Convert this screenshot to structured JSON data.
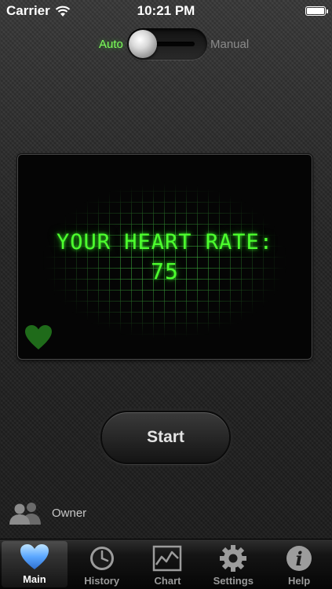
{
  "status_bar": {
    "carrier": "Carrier",
    "time": "10:21 PM"
  },
  "mode": {
    "auto_label": "Auto",
    "manual_label": "Manual",
    "selected": "Auto"
  },
  "display": {
    "title": "YOUR HEART RATE:",
    "value": "75"
  },
  "start_button": {
    "label": "Start"
  },
  "user": {
    "name": "Owner"
  },
  "tabs": [
    {
      "label": "Main",
      "icon": "heart-icon",
      "active": true
    },
    {
      "label": "History",
      "icon": "clock-icon",
      "active": false
    },
    {
      "label": "Chart",
      "icon": "chart-icon",
      "active": false
    },
    {
      "label": "Settings",
      "icon": "gear-icon",
      "active": false
    },
    {
      "label": "Help",
      "icon": "info-icon",
      "active": false
    }
  ],
  "colors": {
    "led_green": "#4dff2e",
    "active_tab_icon": "#5aa7ff"
  }
}
